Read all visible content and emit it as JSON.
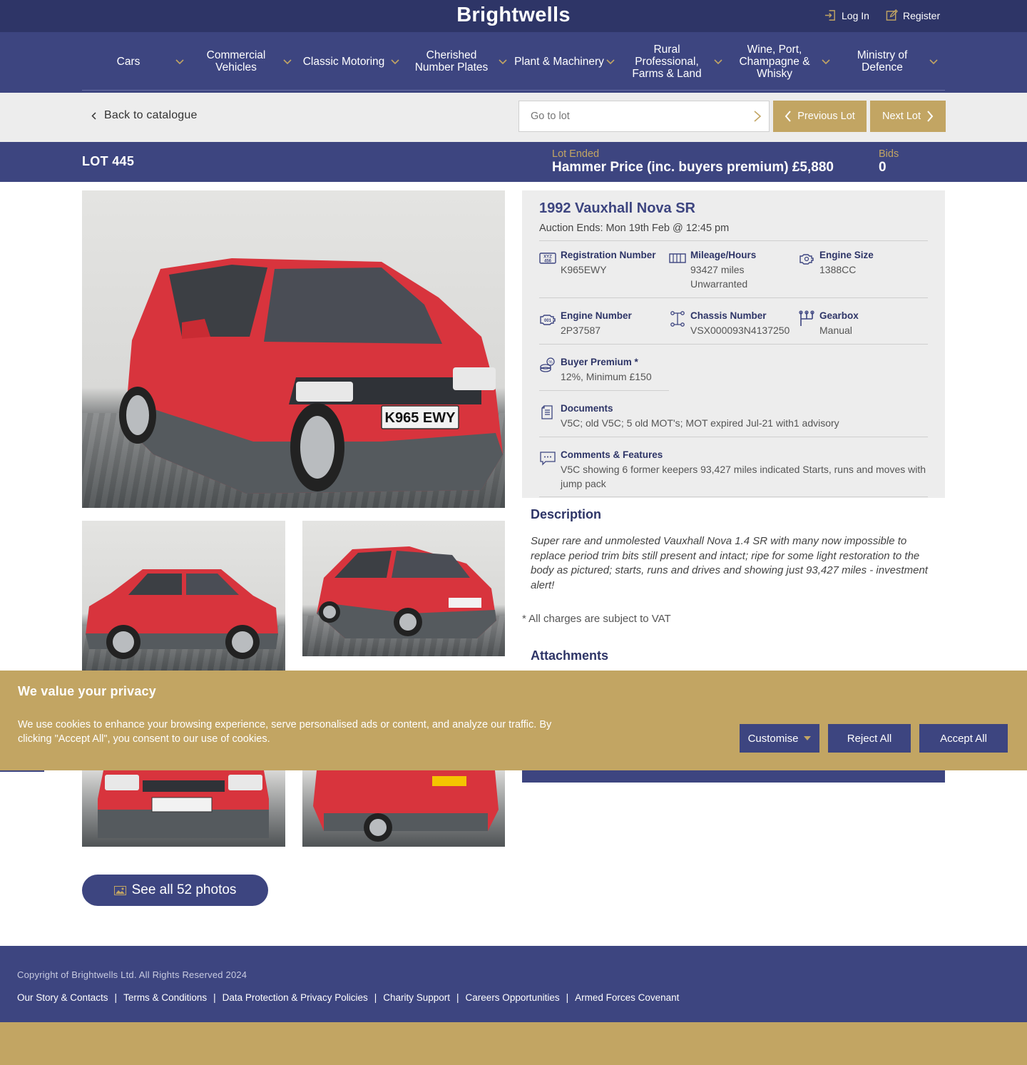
{
  "brand": {
    "name": "Brightwells"
  },
  "auth": {
    "login_label": "Log In",
    "register_label": "Register"
  },
  "nav": {
    "items": [
      {
        "label": "Cars"
      },
      {
        "label": "Commercial Vehicles"
      },
      {
        "label": "Classic Motoring"
      },
      {
        "label": "Cherished Number Plates"
      },
      {
        "label": "Plant & Machinery"
      },
      {
        "label": "Rural Professional, Farms & Land"
      },
      {
        "label": "Wine, Port, Champagne & Whisky"
      },
      {
        "label": "Ministry of Defence"
      }
    ]
  },
  "catalogue": {
    "back_label": "Back to catalogue",
    "goto_placeholder": "Go to lot",
    "previous_label": "Previous Lot",
    "next_label": "Next Lot"
  },
  "lot": {
    "number_label": "LOT 445",
    "status": "Lot Ended",
    "price_label": "Hammer Price (inc. buyers premium) £5,880",
    "bids_label": "Bids",
    "bids_value": "0"
  },
  "vehicle": {
    "title": "1992 Vauxhall Nova SR",
    "auction_ends": "Auction Ends: Mon 19th Feb @ 12:45 pm",
    "specs": [
      {
        "label": "Registration Number",
        "value": "K965EWY",
        "icon": "registration-plate-icon"
      },
      {
        "label": "Mileage/Hours",
        "value": "93427 miles Unwarranted",
        "icon": "odometer-icon"
      },
      {
        "label": "Engine Size",
        "value": "1388CC",
        "icon": "engine-icon"
      },
      {
        "label": "Engine Number",
        "value": "2P37587",
        "icon": "engine-number-icon"
      },
      {
        "label": "Chassis Number",
        "value": "VSX000093N4137250",
        "icon": "chassis-icon"
      },
      {
        "label": "Gearbox",
        "value": "Manual",
        "icon": "gearbox-icon"
      },
      {
        "label": "Buyer Premium *",
        "value": "12%, Minimum £150",
        "icon": "coins-icon"
      },
      {
        "label": "Documents",
        "value": "V5C; old V5C; 5 old MOT's; MOT expired Jul-21 with1 advisory",
        "icon": "document-icon"
      },
      {
        "label": "Comments & Features",
        "value": "V5C showing 6 former keepers 93,427 miles indicated Starts, runs and moves with jump pack",
        "icon": "speech-bubble-icon"
      }
    ],
    "description_title": "Description",
    "description": "Super rare and unmolested Vauxhall Nova 1.4 SR with many now impossible to replace period trim bits still present and intact; ripe for some light restoration to the body as pictured; starts, runs and drives and showing just 93,427 miles - investment alert!",
    "vat_note": "* All charges are subject to VAT",
    "attachments_title": "Attachments",
    "plate_text": "K965 EWY"
  },
  "photos": {
    "see_all_label": "See all 52 photos"
  },
  "cookie": {
    "title": "We value your privacy",
    "text": "We use cookies to enhance your browsing experience, serve personalised ads or content, and analyze our traffic. By clicking \"Accept All\", you consent to our use of cookies.",
    "customise_label": "Customise",
    "reject_label": "Reject All",
    "accept_label": "Accept All"
  },
  "footer": {
    "copyright": "Copyright of Brightwells Ltd. All Rights Reserved 2024",
    "links": [
      "Our Story & Contacts",
      "Terms & Conditions",
      "Data Protection & Privacy Policies",
      "Charity Support",
      "Careers Opportunities",
      "Armed Forces Covenant"
    ]
  },
  "colors": {
    "navy": "#3d4580",
    "navy_dark": "#2e3567",
    "gold": "#c2a563",
    "panel_grey": "#ededed",
    "car_red": "#d8343d"
  }
}
